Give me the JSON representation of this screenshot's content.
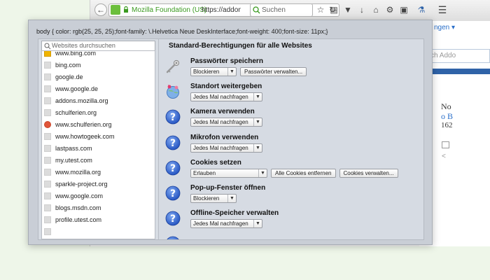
{
  "browser": {
    "url_org": "Mozilla Foundation (US)",
    "url_text": "https://addons.",
    "search_placeholder": "Suchen",
    "behind": {
      "link": "ngen ▾",
      "search_placeholder": "ch Addo",
      "text1": "No",
      "text2": "o B",
      "text3": "162"
    }
  },
  "panel": {
    "css_line": "body { color: rgb(25, 25, 25);font-family: \\.Helvetica Neue DeskInterface;font-weight: 400;font-size: 11px;}",
    "site_search_placeholder": "Websites durchsuchen",
    "sites": [
      {
        "name": "www.bing.com",
        "icon": "bing-favicon",
        "color": "#f0b400"
      },
      {
        "name": "bing.com",
        "icon": "blank-favicon",
        "color": "#dcdcdc"
      },
      {
        "name": "google.de",
        "icon": "blank-favicon",
        "color": "#dcdcdc"
      },
      {
        "name": "www.google.de",
        "icon": "blank-favicon",
        "color": "#dcdcdc"
      },
      {
        "name": "addons.mozilla.org",
        "icon": "blank-favicon",
        "color": "#dcdcdc"
      },
      {
        "name": "schulferien.org",
        "icon": "blank-favicon",
        "color": "#dcdcdc"
      },
      {
        "name": "www.schulferien.org",
        "icon": "schulferien-favicon",
        "color": "#e0553a"
      },
      {
        "name": "www.howtogeek.com",
        "icon": "blank-favicon",
        "color": "#dcdcdc"
      },
      {
        "name": "lastpass.com",
        "icon": "blank-favicon",
        "color": "#dcdcdc"
      },
      {
        "name": "my.utest.com",
        "icon": "blank-favicon",
        "color": "#dcdcdc"
      },
      {
        "name": "www.mozilla.org",
        "icon": "blank-favicon",
        "color": "#dcdcdc"
      },
      {
        "name": "sparkle-project.org",
        "icon": "blank-favicon",
        "color": "#dcdcdc"
      },
      {
        "name": "www.google.com",
        "icon": "blank-favicon",
        "color": "#dcdcdc"
      },
      {
        "name": "blogs.msdn.com",
        "icon": "blank-favicon",
        "color": "#dcdcdc"
      },
      {
        "name": "profile.utest.com",
        "icon": "blank-favicon",
        "color": "#dcdcdc"
      },
      {
        "name": "",
        "icon": "blank-favicon",
        "color": "#dcdcdc"
      }
    ],
    "heading": "Standard-Berechtigungen für alle Websites",
    "permissions": [
      {
        "title": "Passwörter speichern",
        "icon": "key-icon",
        "select": "Blockieren",
        "buttons": [
          "Passwörter verwalten..."
        ]
      },
      {
        "title": "Standort weitergeben",
        "icon": "location-globe-icon",
        "select": "Jedes Mal nachfragen",
        "buttons": []
      },
      {
        "title": "Kamera verwenden",
        "icon": "question-icon",
        "select": "Jedes Mal nachfragen",
        "buttons": []
      },
      {
        "title": "Mikrofon verwenden",
        "icon": "question-icon",
        "select": "Jedes Mal nachfragen",
        "buttons": []
      },
      {
        "title": "Cookies setzen",
        "icon": "question-icon",
        "select": "Erlauben",
        "buttons": [
          "Alle Cookies entfernen",
          "Cookies verwalten..."
        ]
      },
      {
        "title": "Pop-up-Fenster öffnen",
        "icon": "question-icon",
        "select": "Blockieren",
        "buttons": []
      },
      {
        "title": "Offline-Speicher verwalten",
        "icon": "question-icon",
        "select": "Jedes Mal nachfragen",
        "buttons": []
      },
      {
        "title": "",
        "icon": "question-icon",
        "select": "",
        "buttons": []
      }
    ]
  }
}
